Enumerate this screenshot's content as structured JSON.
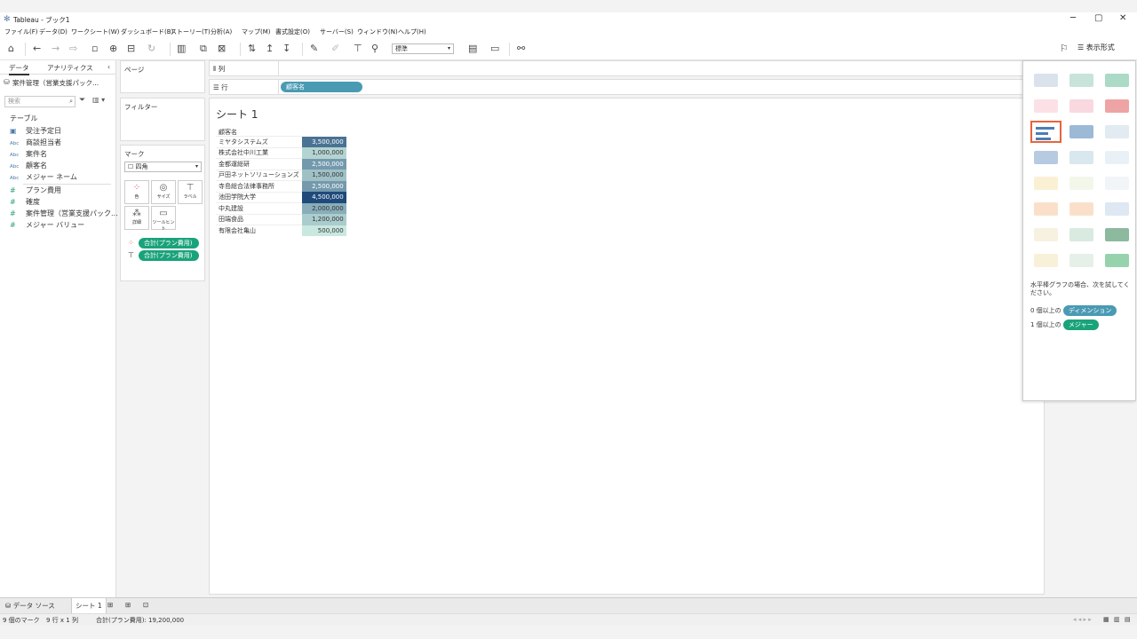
{
  "window": {
    "title": "Tableau - ブック1",
    "minimize": "─",
    "restore": "▢",
    "close": "✕"
  },
  "menu": [
    "ファイル(F)",
    "データ(D)",
    "ワークシート(W)",
    "ダッシュボード(B)",
    "ストーリー(T)",
    "分析(A)",
    "マップ(M)",
    "書式設定(O)",
    "サーバー(S)",
    "ウィンドウ(N)",
    "ヘルプ(H)"
  ],
  "toolbar": {
    "fit_select": "標準",
    "show_me_label": "表示形式"
  },
  "sidebar": {
    "tab_data": "データ",
    "tab_analytics": "アナリティクス",
    "collapse": "‹",
    "datasource": "案件管理（営業支援パック...",
    "search_placeholder": "検索",
    "section_table": "テーブル",
    "fields": [
      {
        "type": "date",
        "icon": "▣",
        "name": "受注予定日"
      },
      {
        "type": "abc",
        "icon": "Abc",
        "name": "商談担当者"
      },
      {
        "type": "abc",
        "icon": "Abc",
        "name": "案件名"
      },
      {
        "type": "abc",
        "icon": "Abc",
        "name": "顧客名"
      },
      {
        "type": "abc",
        "icon": "Abc",
        "name": "メジャー ネーム"
      },
      {
        "type": "measure",
        "icon": "#",
        "name": "プラン費用"
      },
      {
        "type": "measure",
        "icon": "#",
        "name": "確度"
      },
      {
        "type": "measure",
        "icon": "#",
        "name": "案件管理（営業支援パック..."
      },
      {
        "type": "measure",
        "icon": "#",
        "name": "メジャー バリュー"
      }
    ]
  },
  "panels": {
    "pages": "ページ",
    "filters": "フィルター",
    "marks": "マーク",
    "mark_type": "四角",
    "mark_buttons": [
      "色",
      "サイズ",
      "ラベル",
      "詳細",
      "ツールヒント"
    ],
    "mark_pills": [
      "合計(プラン費用)",
      "合計(プラン費用)"
    ]
  },
  "shelves": {
    "columns_label": "列",
    "rows_label": "行",
    "rows_pill": "顧客名"
  },
  "sheet": {
    "title": "シート 1",
    "header": "顧客名",
    "rows": [
      {
        "name": "ミヤタシステムズ",
        "value": "3,500,000",
        "num": 3500000
      },
      {
        "name": "株式会社中川工業",
        "value": "1,000,000",
        "num": 1000000
      },
      {
        "name": "金都運総研",
        "value": "2,500,000",
        "num": 2500000
      },
      {
        "name": "戸田ネットソリューションズ",
        "value": "1,500,000",
        "num": 1500000
      },
      {
        "name": "寺島総合法律事務所",
        "value": "2,500,000",
        "num": 2500000
      },
      {
        "name": "池田学院大学",
        "value": "4,500,000",
        "num": 4500000
      },
      {
        "name": "中丸建設",
        "value": "2,000,000",
        "num": 2000000
      },
      {
        "name": "田端食品",
        "value": "1,200,000",
        "num": 1200000
      },
      {
        "name": "有限会社亀山",
        "value": "500,000",
        "num": 500000
      }
    ]
  },
  "show_me": {
    "hint": "水平棒グラフの場合、次を試してください。",
    "dim_prefix": "0 個以上の",
    "dim_pill": "ディメンション",
    "meas_prefix": "1 個以上の",
    "meas_pill": "メジャー"
  },
  "bottom_tabs": {
    "datasource": "データ ソース",
    "sheet": "シート 1"
  },
  "status": {
    "marks": "9 個のマーク",
    "rows_cols": "9 行 x 1 列",
    "sum": "合計(プラン費用): 19,200,000"
  }
}
